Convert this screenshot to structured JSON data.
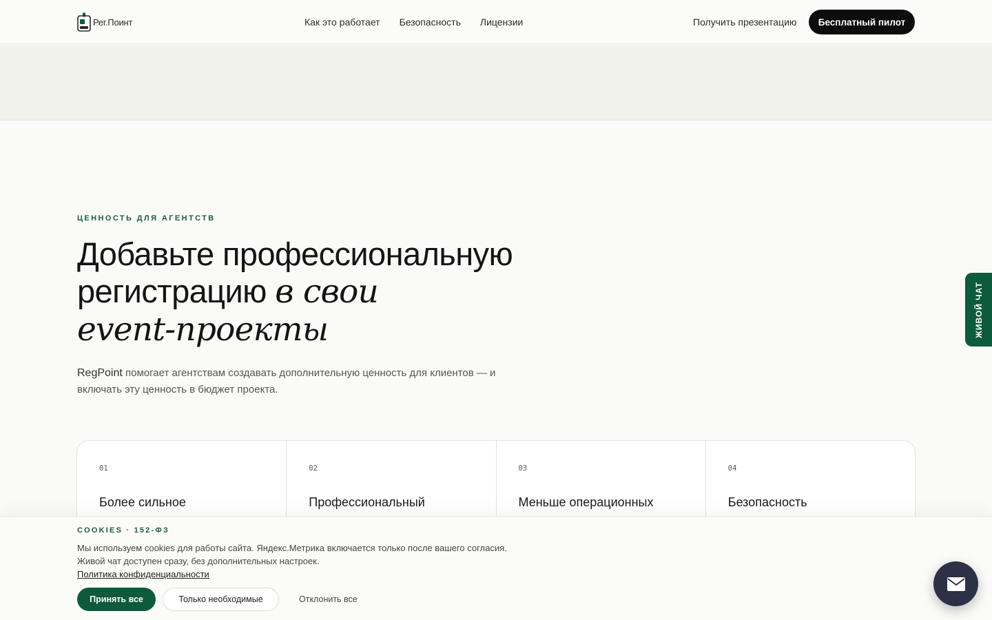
{
  "header": {
    "logo_text": "Рег.Поинт",
    "nav": [
      {
        "label": "Как это работает"
      },
      {
        "label": "Безопасность"
      },
      {
        "label": "Лицензии"
      }
    ],
    "presentation_link": "Получить презентацию",
    "pilot_button": "Бесплатный пилот"
  },
  "hero": {
    "eyebrow": "ЦЕННОСТЬ ДЛЯ АГЕНТСТВ",
    "headline_part1": "Добавьте профессиональную регистрацию ",
    "headline_italic1": "в свои",
    "headline_italic2": "event-проекты",
    "lead_brand": "RegPoint",
    "lead_text": " помогает агентствам создавать дополнительную ценность для клиентов — и включать эту ценность в бюджет проекта."
  },
  "cards": [
    {
      "num": "01",
      "title": "Более сильное"
    },
    {
      "num": "02",
      "title": "Профессиональный"
    },
    {
      "num": "03",
      "title": "Меньше операционных"
    },
    {
      "num": "04",
      "title": "Безопасность"
    }
  ],
  "cookie": {
    "eyebrow": "COOKIES · 152-ФЗ",
    "text": "Мы используем cookies для работы сайта. Яндекс.Метрика включается только после вашего согласия. Живой чат доступен сразу, без дополнительных настроек.",
    "policy_link": "Политика конфиденциальности",
    "accept": "Принять все",
    "necessary": "Только необходимые",
    "decline": "Отклонить все"
  },
  "chat_tab": "ЖИВОЙ ЧАТ",
  "colors": {
    "accent_green": "#0e5a3e",
    "dark": "#0d0d0d",
    "fab": "#2c3147"
  },
  "icons": {
    "logo": "badge-icon",
    "fab": "mail-icon"
  }
}
